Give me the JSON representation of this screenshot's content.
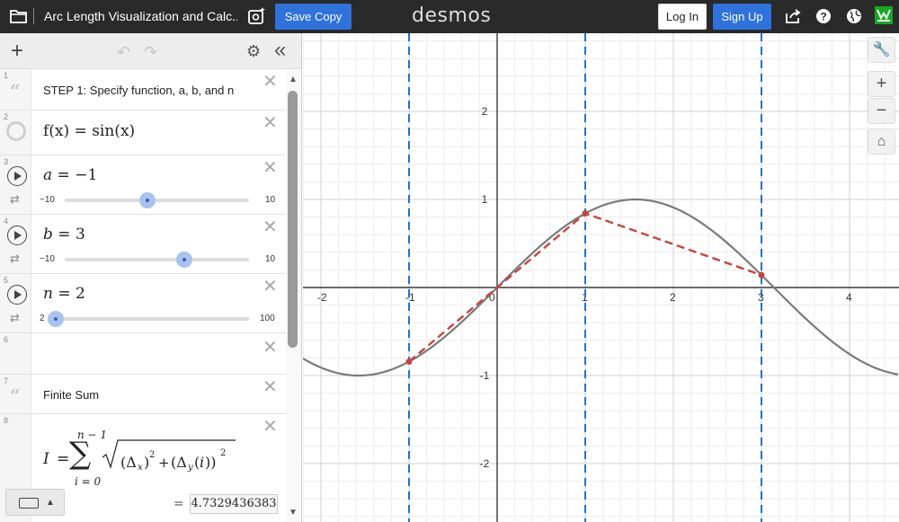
{
  "topbar": {
    "title": "Arc Length Visualization and Calc...",
    "save_copy": "Save Copy",
    "logo": "desmos",
    "login": "Log In",
    "signup": "Sign Up",
    "icons": [
      "folder-icon",
      "screenshot-icon",
      "share-icon",
      "help-icon",
      "language-icon",
      "profile-icon"
    ]
  },
  "panel": {
    "expressions": [
      {
        "num": "1",
        "type": "note",
        "text": "STEP 1: Specify function, a, b, and n"
      },
      {
        "num": "2",
        "type": "expr",
        "text": "f(x) = sin(x)"
      },
      {
        "num": "3",
        "type": "slider",
        "var": "a",
        "value": "−1",
        "min": "−10",
        "max": "10",
        "val": -1,
        "lo": -10,
        "hi": 10
      },
      {
        "num": "4",
        "type": "slider",
        "var": "b",
        "value": "3",
        "min": "−10",
        "max": "10",
        "val": 3,
        "lo": -10,
        "hi": 10
      },
      {
        "num": "5",
        "type": "slider",
        "var": "n",
        "value": "2",
        "min": "2",
        "max": "100",
        "val": 2,
        "lo": 2,
        "hi": 100
      },
      {
        "num": "6",
        "type": "empty"
      },
      {
        "num": "7",
        "type": "note",
        "text": "Finite Sum"
      },
      {
        "num": "8",
        "type": "sum",
        "lhs": "I",
        "upper": "n − 1",
        "lower": "i = 0",
        "result": "4.7329436383"
      }
    ]
  },
  "graph": {
    "x_ticks": [
      "-2",
      "-1",
      "0",
      "1",
      "2",
      "3",
      "4"
    ],
    "y_ticks": [
      "2",
      "1",
      "-1",
      "-2"
    ],
    "tools": {
      "wrench": "wrench-icon",
      "zoom_in": "+",
      "zoom_out": "−",
      "home": "home-icon"
    },
    "colors": {
      "curve": "#7a7a7a",
      "polyline": "#c74440",
      "verticals": "#2d70b3"
    },
    "function": "sin(x)",
    "a": -1,
    "b": 3,
    "x_range": [
      -2.2,
      5.1
    ],
    "y_range": [
      -2.6,
      2.95
    ]
  }
}
